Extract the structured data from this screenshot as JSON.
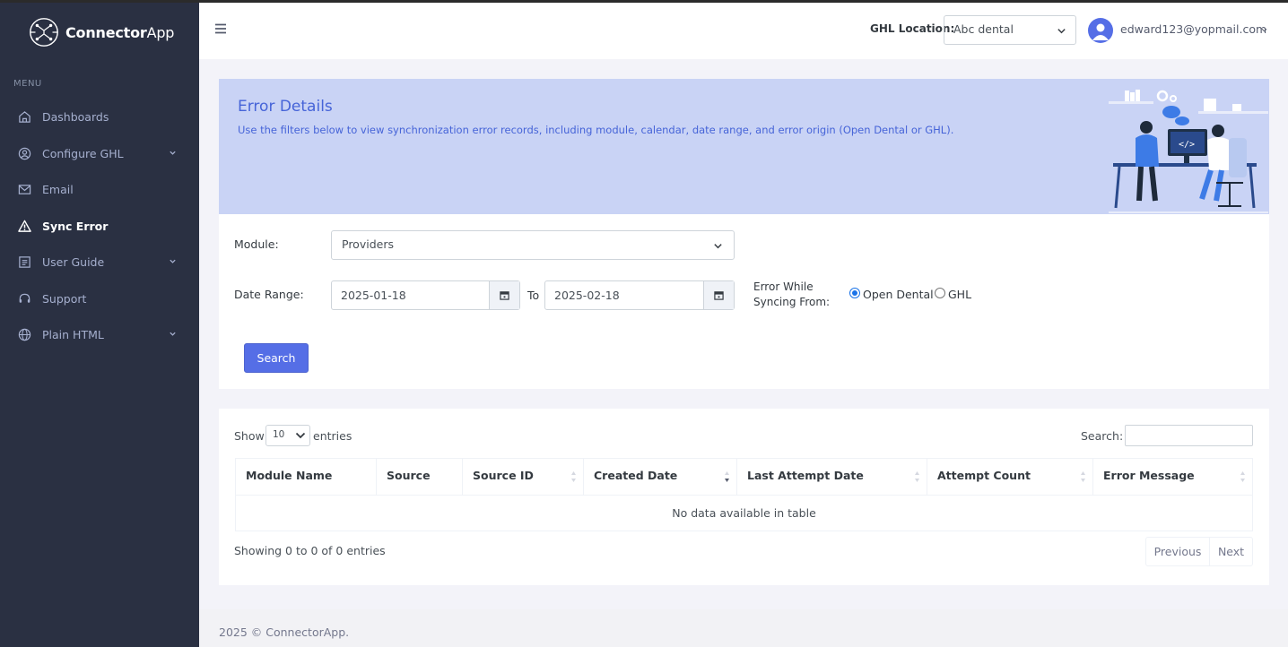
{
  "brand": {
    "name_bold": "Connector",
    "name_light": "App"
  },
  "sidebar": {
    "menu_title": "MENU",
    "items": [
      {
        "label": "Dashboards",
        "icon": "home-icon",
        "has_submenu": false,
        "active": false
      },
      {
        "label": "Configure GHL",
        "icon": "user-circle-icon",
        "has_submenu": true,
        "active": false
      },
      {
        "label": "Email",
        "icon": "mail-icon",
        "has_submenu": false,
        "active": false
      },
      {
        "label": "Sync Error",
        "icon": "warning-icon",
        "has_submenu": false,
        "active": true
      },
      {
        "label": "User Guide",
        "icon": "document-icon",
        "has_submenu": true,
        "active": false
      },
      {
        "label": "Support",
        "icon": "headset-icon",
        "has_submenu": false,
        "active": false
      },
      {
        "label": "Plain HTML",
        "icon": "globe-icon",
        "has_submenu": true,
        "active": false
      }
    ]
  },
  "header": {
    "ghl_location_label": "GHL Location:",
    "ghl_location_value": "Abc dental",
    "user_email": "edward123@yopmail.com"
  },
  "banner": {
    "title": "Error Details",
    "subtitle": "Use the filters below to view synchronization error records, including module, calendar, date range, and error origin (Open Dental or GHL)."
  },
  "filters": {
    "module_label": "Module:",
    "module_value": "Providers",
    "date_range_label": "Date Range:",
    "date_from": "2025-01-18",
    "to_label": "To",
    "date_to": "2025-02-18",
    "sync_from_label_line1": "Error While",
    "sync_from_label_line2": "Syncing From:",
    "options": [
      {
        "label": "Open Dental",
        "selected": true
      },
      {
        "label": "GHL",
        "selected": false
      }
    ],
    "search_button": "Search"
  },
  "table": {
    "show_label": "Show",
    "page_length": "10",
    "entries_label": "entries",
    "search_label": "Search:",
    "search_value": "",
    "columns": [
      "Module Name",
      "Source",
      "Source ID",
      "Created Date",
      "Last Attempt Date",
      "Attempt Count",
      "Error Message"
    ],
    "empty_text": "No data available in table",
    "info": "Showing 0 to 0 of 0 entries",
    "prev_label": "Previous",
    "next_label": "Next"
  },
  "footer": {
    "text": "2025 © ConnectorApp."
  },
  "colors": {
    "sidebar_bg": "#2a3042",
    "primary": "#556ee6",
    "banner_bg": "#c9d3f5",
    "banner_text": "#4664d8"
  }
}
